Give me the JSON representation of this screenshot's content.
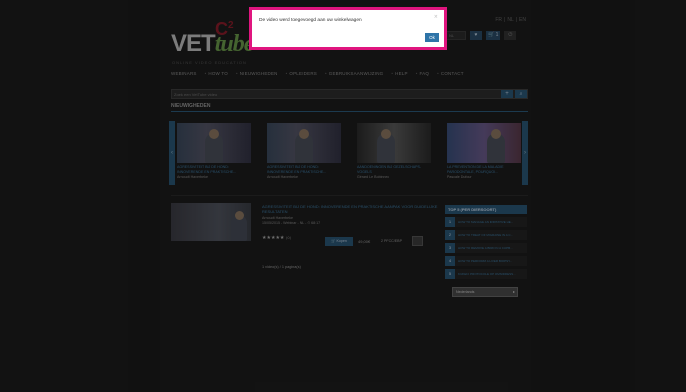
{
  "header": {
    "logo_text": "VET",
    "logo_tube": "tube",
    "logo_c": "C",
    "logo_sup": "2",
    "logo_tagline": "ONLINE VIDEO EDUCATION",
    "lang_fr": "FR",
    "lang_nl": "NL",
    "lang_en": "EN",
    "account_input": "NL",
    "fav_icon": "heart-icon",
    "cart_icon": "cart-icon",
    "cart_count": "1",
    "power_icon": "power-icon"
  },
  "nav": {
    "items": [
      "WEBINARS",
      "HOW TO",
      "NIEUWIGHEDEN",
      "OPLEIDERS",
      "GEBRUIKSAANWIJZING",
      "HELP",
      "FAQ",
      "CONTACT"
    ]
  },
  "search": {
    "placeholder": "Zoek een VetTube video",
    "add_label": "+",
    "go_label": "Q"
  },
  "section": {
    "title": "NIEUWIGHEDEN"
  },
  "carousel": {
    "prev": "‹",
    "next": "›",
    "items": [
      {
        "title": "AGRESSIVITEIT BIJ DE HOND: INNOVERENDE EN PRAKTISCHE...",
        "author": "Arnoudt Haverbeke"
      },
      {
        "title": "AGRESSIVITEIT BIJ DE HOND: INNOVERENDE EN PRAKTISCHE...",
        "author": "Arnoudt Haverbeke"
      },
      {
        "title": "AANDOENINGEN BIJ GEZELSCHAPS-VOGELS",
        "author": "Gérard Le Bobinnec"
      },
      {
        "title": "LA PREVENTION DE LA MALADIE PARODONTALE, POURQUOI...",
        "author": "Pascale Dufour"
      }
    ]
  },
  "result": {
    "title": "AGRESSIVITEIT BIJ DE HOND: INNOVERENDE EN PRAKTISCHE AANPAK VOOR DUIDELIJKE RESULTATEN",
    "author": "Arnoudt Haverbeke",
    "meta": "15/05/2015 - Webinar - NL - ⏱ 68:17",
    "stars": "★★★★★",
    "rating_count": "(0)",
    "cart_label": "🛒 Kopen",
    "price": "49,00€",
    "pe": "2 PFCC/EBP"
  },
  "pager": "1 video(s) / 1 pagina(s)",
  "top5": {
    "title": "TOP 5 (PER DIERSOORT)",
    "items": [
      {
        "num": "1",
        "label": "HOW TO MANAGE AN IRRITATIVE HE..."
      },
      {
        "num": "2",
        "label": "HOW TO TREAT OF MIGRAINE IN A C..."
      },
      {
        "num": "3",
        "label": "HOW TO REMOVE A BIRD IN A CUPB..."
      },
      {
        "num": "4",
        "label": "HOW TO PERFORM A LIVER BIOPSY..."
      },
      {
        "num": "5",
        "label": "KIJKEN: PROTOCOLE OP OMNIDRESS..."
      }
    ],
    "select_value": "Nederlands"
  },
  "modal": {
    "message": "De video werd toegevoegd aan uw winkelwagen",
    "close": "×",
    "ok": "Ok",
    "border_color": "#e0157f"
  }
}
